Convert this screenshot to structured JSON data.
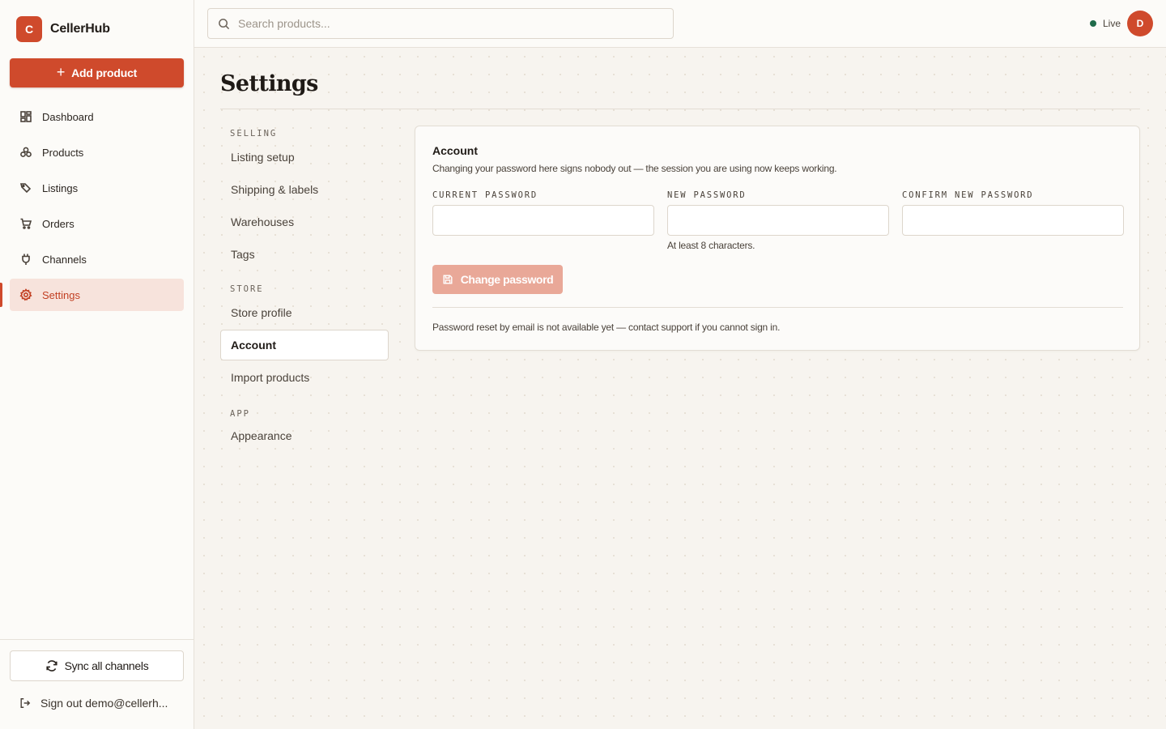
{
  "app": {
    "brand_initial": "C",
    "brand_name": "CellerHub"
  },
  "sidebar": {
    "add_label": "Add product",
    "items": [
      {
        "label": "Dashboard",
        "icon": "dashboard-icon"
      },
      {
        "label": "Products",
        "icon": "products-icon"
      },
      {
        "label": "Listings",
        "icon": "tag-icon"
      },
      {
        "label": "Orders",
        "icon": "cart-icon"
      },
      {
        "label": "Channels",
        "icon": "plug-icon"
      },
      {
        "label": "Settings",
        "icon": "gear-icon",
        "active": true
      }
    ],
    "sync_label": "Sync all channels",
    "signout_label": "Sign out demo@cellerh..."
  },
  "topbar": {
    "search_placeholder": "Search products...",
    "status_label": "Live",
    "status_color": "#1f6b4a",
    "avatar_initial": "D"
  },
  "page": {
    "title": "Settings"
  },
  "settings_nav": {
    "groups": [
      {
        "label": "SELLING",
        "items": [
          "Listing setup",
          "Shipping & labels",
          "Warehouses",
          "Tags"
        ]
      },
      {
        "label": "STORE",
        "items": [
          "Store profile",
          "Account",
          "Import products"
        ]
      },
      {
        "label": "APP",
        "items": [
          "Appearance"
        ]
      }
    ],
    "active_item": "Account"
  },
  "account": {
    "title": "Account",
    "description": "Changing your password here signs nobody out — the session you are using now keeps working.",
    "current_password_label": "CURRENT PASSWORD",
    "current_password_value": "",
    "new_password_label": "NEW PASSWORD",
    "new_password_value": "",
    "new_password_hint": "At least 8 characters.",
    "confirm_password_label": "CONFIRM NEW PASSWORD",
    "confirm_password_value": "",
    "submit_label": "Change password",
    "footer_note": "Password reset by email is not available yet — contact support if you cannot sign in."
  },
  "colors": {
    "accent": "#cf4a2c",
    "accent_soft": "#f7e3dc",
    "button_disabled": "#e9a898"
  }
}
